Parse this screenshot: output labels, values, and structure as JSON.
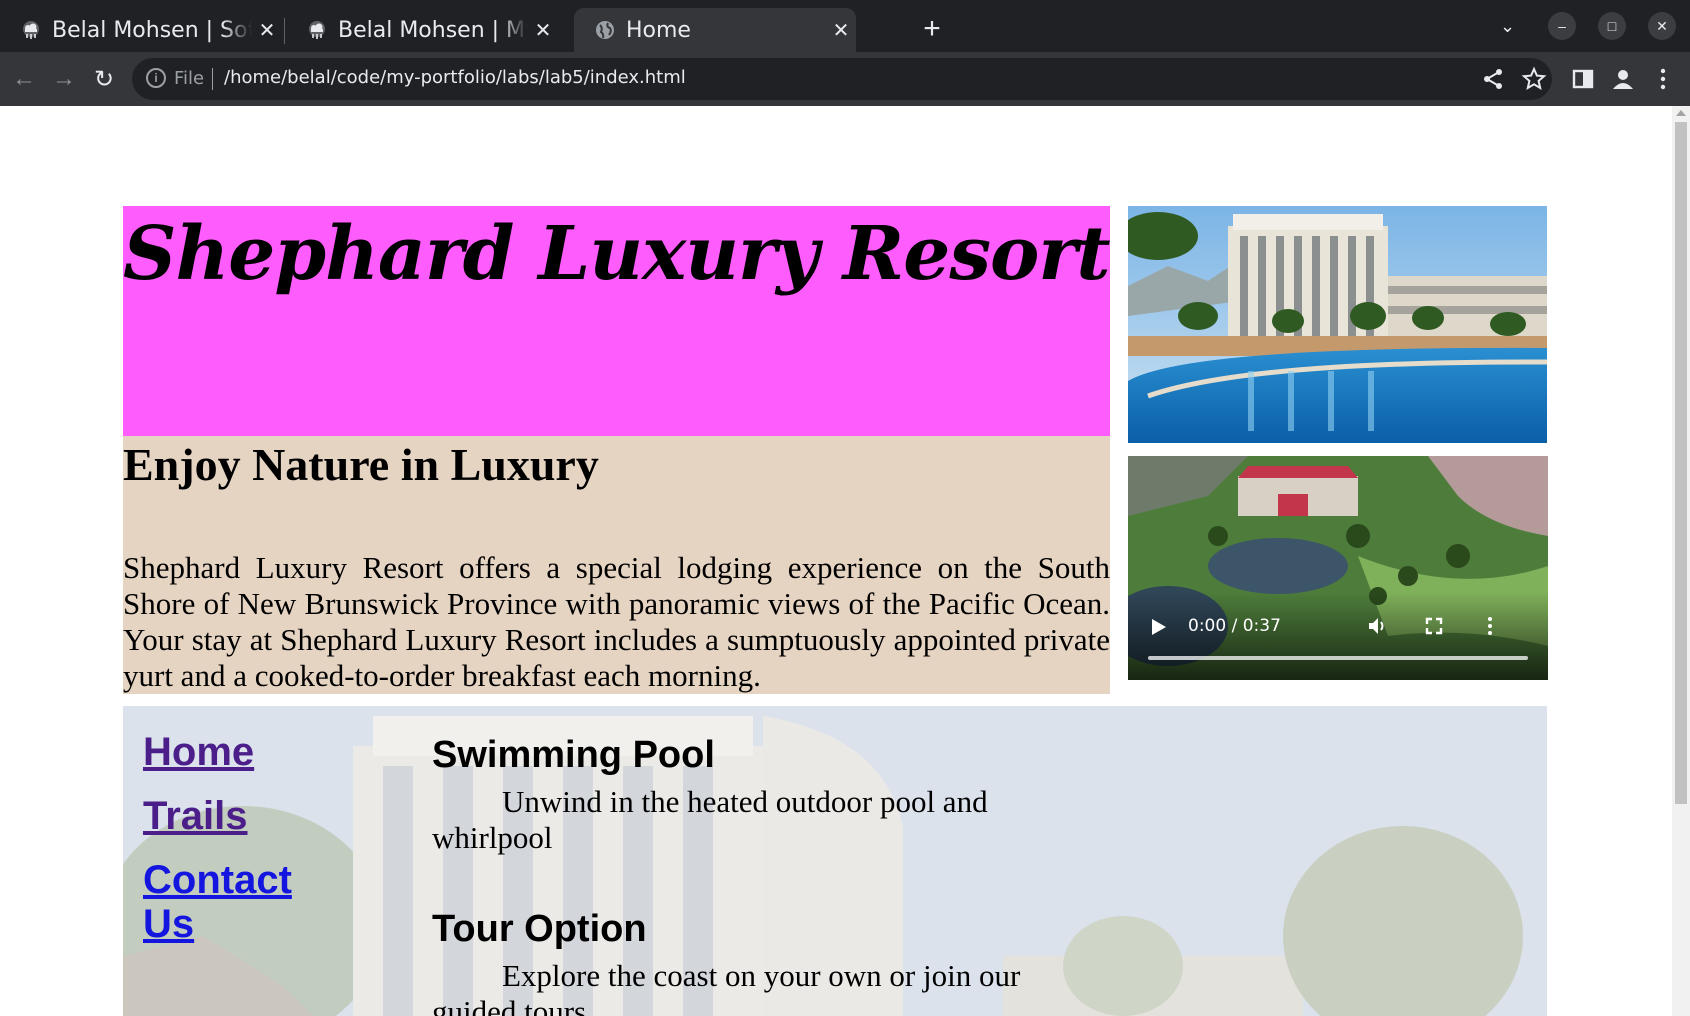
{
  "browser": {
    "tabs": [
      {
        "title": "Belal Mohsen | Software Engineer",
        "active": false,
        "favicon": "cloud-icon"
      },
      {
        "title": "Belal Mohsen | My Labs",
        "active": false,
        "favicon": "cloud-icon"
      },
      {
        "title": "Home",
        "active": true,
        "favicon": "globe-icon"
      }
    ],
    "close_glyph": "✕",
    "new_tab_glyph": "+",
    "tab_search_glyph": "⌄",
    "window_controls": {
      "minimize": "–",
      "maximize": "□",
      "close": "✕"
    },
    "nav": {
      "back": "←",
      "forward": "→",
      "reload": "↻"
    },
    "address": {
      "scheme_label": "File",
      "url": "/home/belal/code/my-portfolio/labs/lab5/index.html",
      "info_icon": "info-icon"
    },
    "toolbar_icons": [
      "share-icon",
      "star-icon",
      "side-panel-icon",
      "profile-icon",
      "kebab-menu-icon"
    ],
    "colors": {
      "frame": "#202124",
      "toolbar": "#35363a",
      "text": "#e8eaed"
    }
  },
  "page": {
    "hero": {
      "title": "Shephard Luxury Resort",
      "bg": "#ff5cfd"
    },
    "intro": {
      "heading": "Enjoy Nature in Luxury",
      "text": "Shephard Luxury Resort offers a special lodging experience on the South Shore of New Brunswick Province with panoramic views of the Pacific Ocean. Your stay at Shephard Luxury Resort includes a sumptuously appointed private yurt and a cooked-to-order breakfast each morning.",
      "bg": "#e6d4c3"
    },
    "video": {
      "time": "0:00 / 0:37",
      "progress": 0
    },
    "nav": {
      "home": "Home",
      "trails": "Trails",
      "contact": "Contact Us"
    },
    "sections": [
      {
        "heading": "Swimming Pool",
        "text": "Unwind in the heated outdoor pool and whirlpool"
      },
      {
        "heading": "Tour Option",
        "text": "Explore the coast on your own or join our guided tours"
      }
    ]
  }
}
